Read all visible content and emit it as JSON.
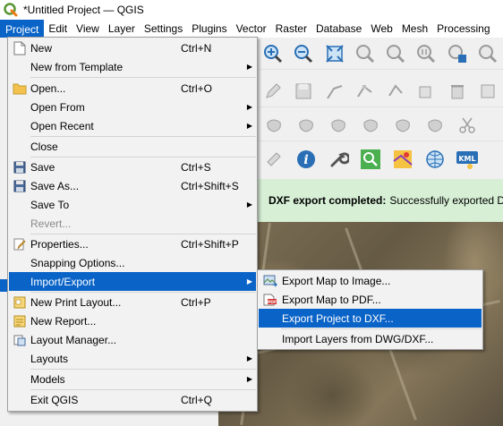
{
  "window": {
    "title": "*Untitled Project — QGIS",
    "app_icon": "qgis-logo-icon"
  },
  "menubar": {
    "items": [
      {
        "label": "Project"
      },
      {
        "label": "Edit"
      },
      {
        "label": "View"
      },
      {
        "label": "Layer"
      },
      {
        "label": "Settings"
      },
      {
        "label": "Plugins"
      },
      {
        "label": "Vector"
      },
      {
        "label": "Raster"
      },
      {
        "label": "Database"
      },
      {
        "label": "Web"
      },
      {
        "label": "Mesh"
      },
      {
        "label": "Processing"
      }
    ]
  },
  "project_menu": {
    "items": [
      {
        "label": "New",
        "shortcut": "Ctrl+N",
        "icon": "new-document-icon"
      },
      {
        "label": "New from Template",
        "submenu": true
      },
      {
        "label": "Open...",
        "shortcut": "Ctrl+O",
        "icon": "folder-open-icon"
      },
      {
        "label": "Open From",
        "submenu": true
      },
      {
        "label": "Open Recent",
        "submenu": true
      },
      {
        "label": "Close"
      },
      {
        "label": "Save",
        "shortcut": "Ctrl+S",
        "icon": "floppy-disk-icon"
      },
      {
        "label": "Save As...",
        "shortcut": "Ctrl+Shift+S",
        "icon": "floppy-disk-as-icon"
      },
      {
        "label": "Save To",
        "submenu": true
      },
      {
        "label": "Revert...",
        "disabled": true
      },
      {
        "label": "Properties...",
        "shortcut": "Ctrl+Shift+P",
        "icon": "properties-pencil-icon"
      },
      {
        "label": "Snapping Options..."
      },
      {
        "label": "Import/Export",
        "submenu": true,
        "highlighted": true
      },
      {
        "label": "New Print Layout...",
        "shortcut": "Ctrl+P",
        "icon": "new-print-layout-icon"
      },
      {
        "label": "New Report...",
        "icon": "new-report-icon"
      },
      {
        "label": "Layout Manager...",
        "icon": "layout-manager-icon"
      },
      {
        "label": "Layouts",
        "submenu": true
      },
      {
        "label": "Models",
        "submenu": true
      },
      {
        "label": "Exit QGIS",
        "shortcut": "Ctrl+Q"
      }
    ]
  },
  "import_export_submenu": {
    "items": [
      {
        "label": "Export Map to Image...",
        "icon": "export-image-icon"
      },
      {
        "label": "Export Map to PDF...",
        "icon": "export-pdf-icon"
      },
      {
        "label": "Export Project to DXF...",
        "highlighted": true
      },
      {
        "label": "Import Layers from DWG/DXF..."
      }
    ]
  },
  "message_bar": {
    "title": "DXF export completed:",
    "text": "Successfully exported DXF"
  },
  "colors": {
    "highlight": "#0a64c8",
    "message_bar_bg": "#d6efd5"
  }
}
